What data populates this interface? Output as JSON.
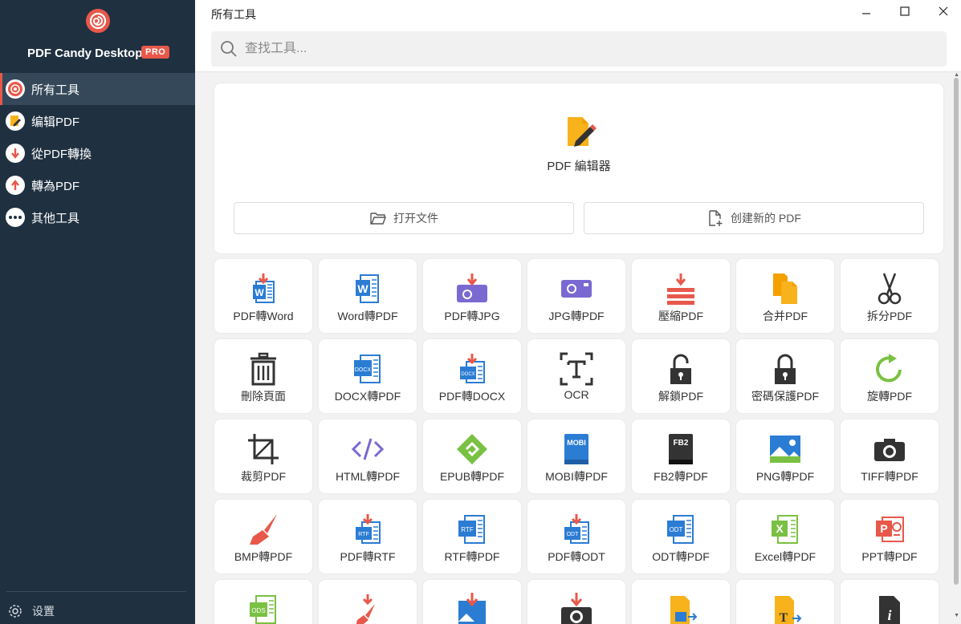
{
  "app": {
    "brand": "PDF Candy Desktop",
    "badge": "PRO",
    "window_title": "所有工具"
  },
  "colors": {
    "sidebar_bg": "#1f3040",
    "accent": "#e8584a",
    "active_nav_bg": "#344859"
  },
  "sidebar": {
    "items": [
      {
        "label": "所有工具",
        "icon": "all-tools-icon",
        "active": true
      },
      {
        "label": "编辑PDF",
        "icon": "edit-pdf-icon",
        "active": false
      },
      {
        "label": "從PDF轉換",
        "icon": "arrow-down-icon",
        "active": false
      },
      {
        "label": "轉為PDF",
        "icon": "arrow-up-icon",
        "active": false
      },
      {
        "label": "其他工具",
        "icon": "more-dots-icon",
        "active": false
      }
    ],
    "settings_label": "设置"
  },
  "search": {
    "placeholder": "查找工具..."
  },
  "hero": {
    "title": "PDF 編辑器",
    "open_file_label": "打开文件",
    "create_new_label": "创建新的 PDF"
  },
  "tools": [
    {
      "label": "PDF轉Word",
      "icon": "pdf-to-word-icon"
    },
    {
      "label": "Word轉PDF",
      "icon": "word-to-pdf-icon"
    },
    {
      "label": "PDF轉JPG",
      "icon": "pdf-to-jpg-icon"
    },
    {
      "label": "JPG轉PDF",
      "icon": "jpg-to-pdf-icon"
    },
    {
      "label": "壓縮PDF",
      "icon": "compress-pdf-icon"
    },
    {
      "label": "合并PDF",
      "icon": "merge-pdf-icon"
    },
    {
      "label": "拆分PDF",
      "icon": "split-pdf-icon"
    },
    {
      "label": "刪除頁面",
      "icon": "delete-pages-icon"
    },
    {
      "label": "DOCX轉PDF",
      "icon": "docx-to-pdf-icon"
    },
    {
      "label": "PDF轉DOCX",
      "icon": "pdf-to-docx-icon"
    },
    {
      "label": "OCR",
      "icon": "ocr-icon"
    },
    {
      "label": "解鎖PDF",
      "icon": "unlock-pdf-icon"
    },
    {
      "label": "密碼保護PDF",
      "icon": "protect-pdf-icon"
    },
    {
      "label": "旋轉PDF",
      "icon": "rotate-pdf-icon"
    },
    {
      "label": "裁剪PDF",
      "icon": "crop-pdf-icon"
    },
    {
      "label": "HTML轉PDF",
      "icon": "html-to-pdf-icon"
    },
    {
      "label": "EPUB轉PDF",
      "icon": "epub-to-pdf-icon"
    },
    {
      "label": "MOBI轉PDF",
      "icon": "mobi-to-pdf-icon"
    },
    {
      "label": "FB2轉PDF",
      "icon": "fb2-to-pdf-icon"
    },
    {
      "label": "PNG轉PDF",
      "icon": "png-to-pdf-icon"
    },
    {
      "label": "TIFF轉PDF",
      "icon": "tiff-to-pdf-icon"
    },
    {
      "label": "BMP轉PDF",
      "icon": "bmp-to-pdf-icon"
    },
    {
      "label": "PDF轉RTF",
      "icon": "pdf-to-rtf-icon"
    },
    {
      "label": "RTF轉PDF",
      "icon": "rtf-to-pdf-icon"
    },
    {
      "label": "PDF轉ODT",
      "icon": "pdf-to-odt-icon"
    },
    {
      "label": "ODT轉PDF",
      "icon": "odt-to-pdf-icon"
    },
    {
      "label": "Excel轉PDF",
      "icon": "excel-to-pdf-icon"
    },
    {
      "label": "PPT轉PDF",
      "icon": "ppt-to-pdf-icon"
    },
    {
      "label": "",
      "icon": "ods-to-pdf-icon"
    },
    {
      "label": "",
      "icon": "pdf-to-bmp-icon"
    },
    {
      "label": "",
      "icon": "pdf-to-png-icon"
    },
    {
      "label": "",
      "icon": "pdf-to-tiff-icon"
    },
    {
      "label": "",
      "icon": "image-to-pdf-icon"
    },
    {
      "label": "",
      "icon": "txt-to-pdf-icon"
    },
    {
      "label": "",
      "icon": "pdf-info-icon"
    }
  ]
}
